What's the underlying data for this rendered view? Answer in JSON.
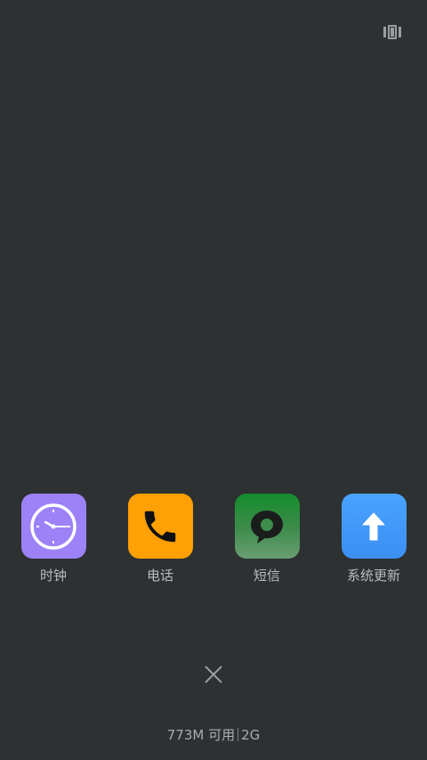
{
  "top_action": {
    "icon": "task-manager-icon"
  },
  "apps": [
    {
      "label": "时钟",
      "icon": "clock-icon",
      "color": "#9c82f6"
    },
    {
      "label": "电话",
      "icon": "phone-icon",
      "color": "#ffa004"
    },
    {
      "label": "短信",
      "icon": "message-bubble-icon",
      "color": "#148c2a"
    },
    {
      "label": "系统更新",
      "icon": "up-arrow-icon",
      "color": "#4aa3ff"
    }
  ],
  "close": {
    "icon": "close-icon"
  },
  "memory": {
    "available": "773M 可用",
    "total": "2G"
  },
  "colors": {
    "background": "#2d3132",
    "label": "#b8bcbd"
  }
}
